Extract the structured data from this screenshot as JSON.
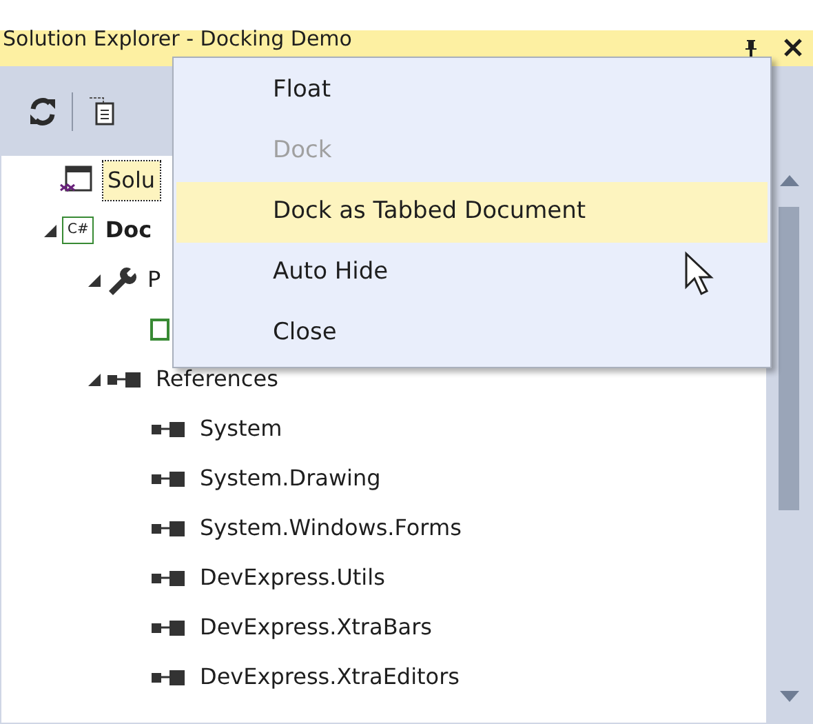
{
  "panel": {
    "title": "Solution Explorer - Docking Demo"
  },
  "toolbar": {
    "buttons": [
      {
        "kind": "sync"
      },
      {
        "kind": "properties"
      }
    ]
  },
  "tree": [
    {
      "kind": "solution",
      "label": "Solu",
      "selected": true,
      "children": [
        {
          "kind": "csharp-project",
          "icon_text": "C#",
          "label": "Doc",
          "expanded": true,
          "selected": false,
          "children": [
            {
              "kind": "properties",
              "label": "P",
              "expanded": true,
              "selected": false,
              "children": [
                {
                  "kind": "settings",
                  "selected": false
                }
              ]
            },
            {
              "kind": "references",
              "label": "References",
              "expanded": true,
              "selected": false,
              "children": [
                {
                  "kind": "reference",
                  "label": "System",
                  "selected": false
                },
                {
                  "kind": "reference",
                  "label": "System.Drawing",
                  "selected": false
                },
                {
                  "kind": "reference",
                  "label": "System.Windows.Forms",
                  "selected": false
                },
                {
                  "kind": "reference",
                  "label": "DevExpress.Utils",
                  "selected": false
                },
                {
                  "kind": "reference",
                  "label": "DevExpress.XtraBars",
                  "selected": false
                },
                {
                  "kind": "reference",
                  "label": "DevExpress.XtraEditors",
                  "selected": false
                }
              ]
            }
          ]
        }
      ]
    }
  ],
  "context_menu": {
    "items": [
      {
        "label": "Float",
        "disabled": false,
        "selected": false
      },
      {
        "label": "Dock",
        "disabled": true,
        "selected": false
      },
      {
        "label": "Dock as Tabbed Document",
        "disabled": false,
        "selected": true
      },
      {
        "label": "Auto Hide",
        "disabled": false,
        "selected": false
      },
      {
        "label": "Close",
        "disabled": false,
        "selected": false
      }
    ]
  }
}
